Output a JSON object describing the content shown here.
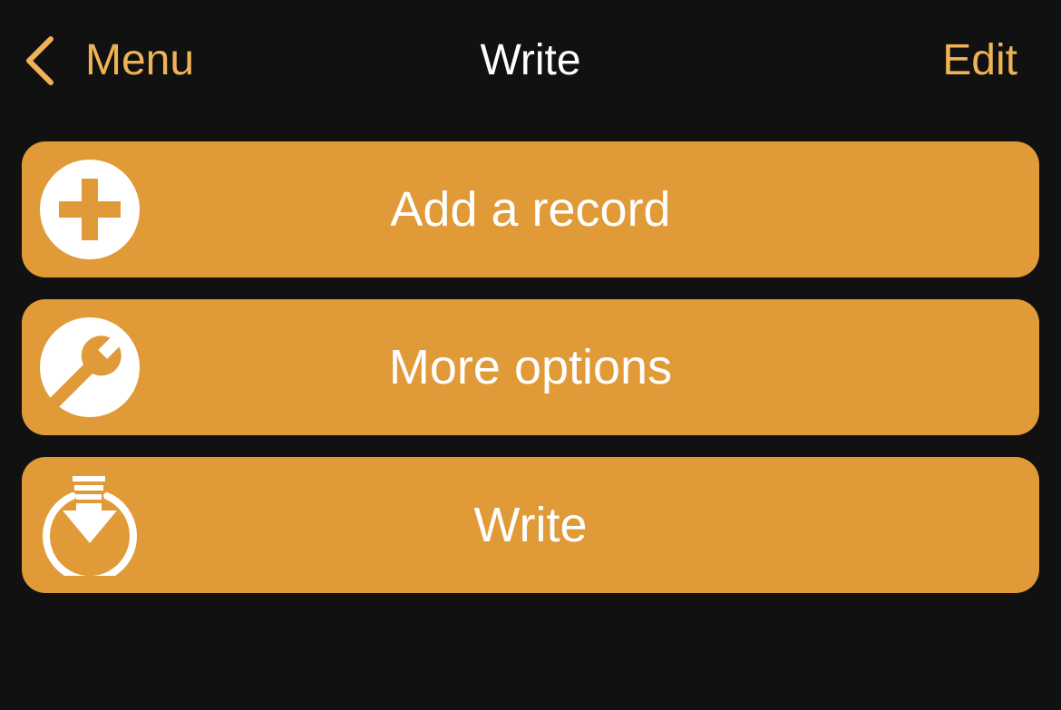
{
  "navbar": {
    "back_label": "Menu",
    "title": "Write",
    "edit_label": "Edit"
  },
  "actions": [
    {
      "label": "Add a record",
      "icon": "plus-circle-icon"
    },
    {
      "label": "More options",
      "icon": "wrench-icon"
    },
    {
      "label": "Write",
      "icon": "download-arrow-icon"
    }
  ],
  "colors": {
    "background": "#111111",
    "accent": "#EFB356",
    "button": "#E09A37",
    "text": "#FFFFFF"
  }
}
